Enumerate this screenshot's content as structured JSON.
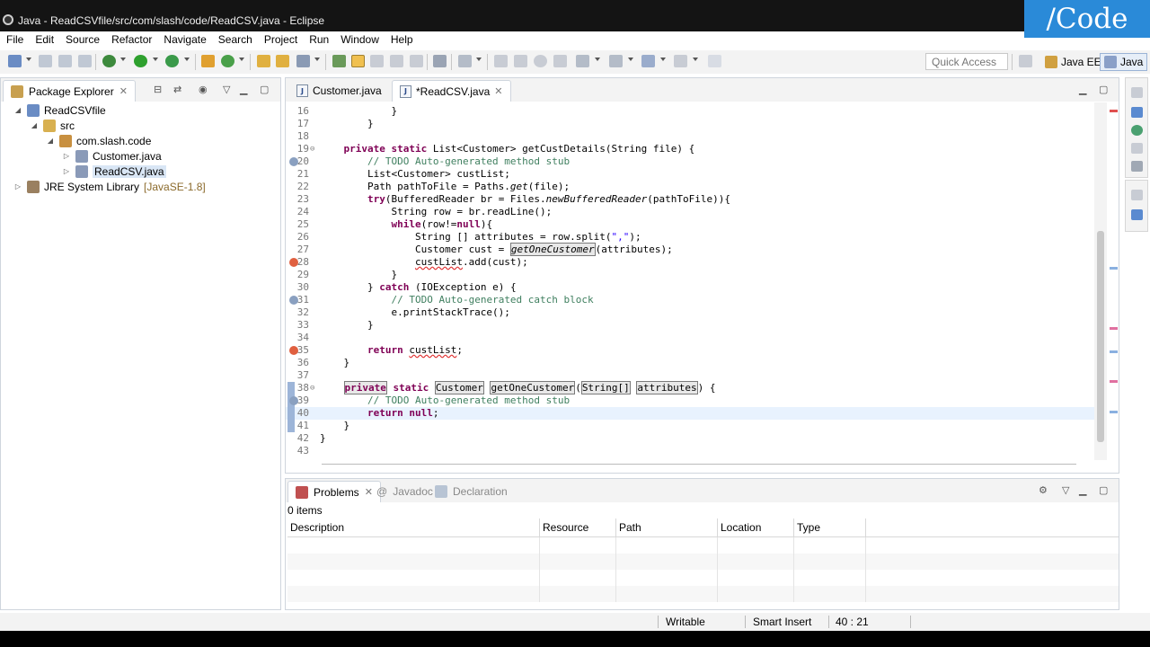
{
  "window": {
    "title": "Java - ReadCSVfile/src/com/slash/code/ReadCSV.java - Eclipse",
    "brand": "/Code"
  },
  "menu": [
    "File",
    "Edit",
    "Source",
    "Refactor",
    "Navigate",
    "Search",
    "Project",
    "Run",
    "Window",
    "Help"
  ],
  "toolbar": {
    "quick_access": "Quick Access",
    "perspectives": [
      {
        "label": "Java EE",
        "active": false
      },
      {
        "label": "Java",
        "active": true
      }
    ]
  },
  "package_explorer": {
    "title": "Package Explorer",
    "tree": [
      {
        "label": "ReadCSVfile",
        "decor": "",
        "depth": 0,
        "twist": "expanded",
        "icon": "project-icon"
      },
      {
        "label": "src",
        "decor": "",
        "depth": 1,
        "twist": "expanded",
        "icon": "source-folder-icon"
      },
      {
        "label": "com.slash.code",
        "decor": "",
        "depth": 2,
        "twist": "expanded",
        "icon": "package-icon"
      },
      {
        "label": "Customer.java",
        "decor": "",
        "depth": 3,
        "twist": "collapsed",
        "icon": "java-file-icon"
      },
      {
        "label": "ReadCSV.java",
        "decor": "",
        "depth": 3,
        "twist": "collapsed",
        "icon": "java-file-icon",
        "selected": true
      },
      {
        "label": "JRE System Library",
        "decor": "[JavaSE-1.8]",
        "depth": 0,
        "twist": "collapsed",
        "icon": "library-icon"
      }
    ]
  },
  "editor": {
    "tabs": [
      {
        "label": "Customer.java",
        "active": false,
        "closable": false
      },
      {
        "label": "*ReadCSV.java",
        "active": true,
        "closable": true
      }
    ],
    "lines": [
      {
        "n": "16",
        "segs": [
          {
            "t": "            }",
            "c": ""
          }
        ]
      },
      {
        "n": "17",
        "segs": [
          {
            "t": "        }",
            "c": ""
          }
        ]
      },
      {
        "n": "18",
        "segs": [
          {
            "t": "",
            "c": ""
          }
        ]
      },
      {
        "n": "19",
        "fold": true,
        "segs": [
          {
            "t": "    ",
            "c": ""
          },
          {
            "t": "private static",
            "c": "kw"
          },
          {
            "t": " List<Customer> getCustDetails(String file) {",
            "c": ""
          }
        ]
      },
      {
        "n": "20",
        "gutter": "task",
        "segs": [
          {
            "t": "        ",
            "c": ""
          },
          {
            "t": "// TODO Auto-generated method stub",
            "c": "cm"
          }
        ]
      },
      {
        "n": "21",
        "segs": [
          {
            "t": "        List<Customer> custList;",
            "c": ""
          }
        ]
      },
      {
        "n": "22",
        "segs": [
          {
            "t": "        Path pathToFile = Paths.",
            "c": ""
          },
          {
            "t": "get",
            "c": "it"
          },
          {
            "t": "(file);",
            "c": ""
          }
        ]
      },
      {
        "n": "23",
        "segs": [
          {
            "t": "        ",
            "c": ""
          },
          {
            "t": "try",
            "c": "kw"
          },
          {
            "t": "(BufferedReader br = Files.",
            "c": ""
          },
          {
            "t": "newBufferedReader",
            "c": "it"
          },
          {
            "t": "(pathToFile)){",
            "c": ""
          }
        ]
      },
      {
        "n": "24",
        "segs": [
          {
            "t": "            String row = br.readLine();",
            "c": ""
          }
        ]
      },
      {
        "n": "25",
        "segs": [
          {
            "t": "            ",
            "c": ""
          },
          {
            "t": "while",
            "c": "kw"
          },
          {
            "t": "(row!=",
            "c": ""
          },
          {
            "t": "null",
            "c": "kw"
          },
          {
            "t": "){",
            "c": ""
          }
        ]
      },
      {
        "n": "26",
        "segs": [
          {
            "t": "                String [] attributes = row.split(",
            "c": ""
          },
          {
            "t": "\",\"",
            "c": "st"
          },
          {
            "t": ");",
            "c": ""
          }
        ]
      },
      {
        "n": "27",
        "segs": [
          {
            "t": "                Customer cust = ",
            "c": ""
          },
          {
            "t": "getOneCustomer",
            "c": "it occ"
          },
          {
            "t": "(attributes);",
            "c": ""
          }
        ]
      },
      {
        "n": "28",
        "gutter": "error",
        "segs": [
          {
            "t": "                ",
            "c": ""
          },
          {
            "t": "custList",
            "c": "err"
          },
          {
            "t": ".add(cust);",
            "c": ""
          }
        ]
      },
      {
        "n": "29",
        "segs": [
          {
            "t": "            }",
            "c": ""
          }
        ]
      },
      {
        "n": "30",
        "segs": [
          {
            "t": "        } ",
            "c": ""
          },
          {
            "t": "catch",
            "c": "kw"
          },
          {
            "t": " (IOException e) {",
            "c": ""
          }
        ]
      },
      {
        "n": "31",
        "gutter": "task",
        "segs": [
          {
            "t": "            ",
            "c": ""
          },
          {
            "t": "// TODO Auto-generated catch block",
            "c": "cm"
          }
        ]
      },
      {
        "n": "32",
        "segs": [
          {
            "t": "            e.printStackTrace();",
            "c": ""
          }
        ]
      },
      {
        "n": "33",
        "segs": [
          {
            "t": "        }",
            "c": ""
          }
        ]
      },
      {
        "n": "34",
        "segs": [
          {
            "t": "",
            "c": ""
          }
        ]
      },
      {
        "n": "35",
        "gutter": "error",
        "segs": [
          {
            "t": "        ",
            "c": ""
          },
          {
            "t": "return",
            "c": "kw"
          },
          {
            "t": " ",
            "c": ""
          },
          {
            "t": "custList",
            "c": "err"
          },
          {
            "t": ";",
            "c": ""
          }
        ]
      },
      {
        "n": "36",
        "segs": [
          {
            "t": "    }",
            "c": ""
          }
        ]
      },
      {
        "n": "37",
        "segs": [
          {
            "t": "",
            "c": ""
          }
        ]
      },
      {
        "n": "38",
        "fold": true,
        "marker": true,
        "segs": [
          {
            "t": "    ",
            "c": ""
          },
          {
            "t": "private",
            "c": "kw occ"
          },
          {
            "t": " ",
            "c": ""
          },
          {
            "t": "static",
            "c": "kw"
          },
          {
            "t": " ",
            "c": ""
          },
          {
            "t": "Customer",
            "c": "occ"
          },
          {
            "t": " ",
            "c": ""
          },
          {
            "t": "getOneCustomer",
            "c": "occ"
          },
          {
            "t": "(",
            "c": ""
          },
          {
            "t": "String[]",
            "c": "occ"
          },
          {
            "t": " ",
            "c": ""
          },
          {
            "t": "attributes",
            "c": "occ"
          },
          {
            "t": ") {",
            "c": ""
          }
        ]
      },
      {
        "n": "39",
        "marker": true,
        "gutter": "task",
        "segs": [
          {
            "t": "        ",
            "c": ""
          },
          {
            "t": "// TODO Auto-generated method stub",
            "c": "cm"
          }
        ]
      },
      {
        "n": "40",
        "marker": true,
        "current": true,
        "segs": [
          {
            "t": "        ",
            "c": ""
          },
          {
            "t": "return",
            "c": "kw"
          },
          {
            "t": " ",
            "c": ""
          },
          {
            "t": "null",
            "c": "kw"
          },
          {
            "t": ";",
            "c": ""
          }
        ]
      },
      {
        "n": "41",
        "marker": true,
        "segs": [
          {
            "t": "    }",
            "c": ""
          }
        ]
      },
      {
        "n": "42",
        "segs": [
          {
            "t": "}",
            "c": ""
          }
        ]
      },
      {
        "n": "43",
        "segs": [
          {
            "t": "",
            "c": ""
          }
        ]
      }
    ]
  },
  "bottom_views": {
    "tabs": [
      {
        "label": "Problems",
        "active": true,
        "closable": true
      },
      {
        "label": "Javadoc",
        "active": false,
        "closable": false
      },
      {
        "label": "Declaration",
        "active": false,
        "closable": false
      }
    ],
    "count": "0 items",
    "columns": [
      "Description",
      "Resource",
      "Path",
      "Location",
      "Type"
    ]
  },
  "status": {
    "writable": "Writable",
    "insert_mode": "Smart Insert",
    "position": "40 : 21"
  },
  "colors": {
    "keyword": "#7f0055",
    "comment": "#3f7f5f",
    "string": "#2a00ff",
    "error": "#e03030",
    "brand": "#2a8ad8"
  }
}
